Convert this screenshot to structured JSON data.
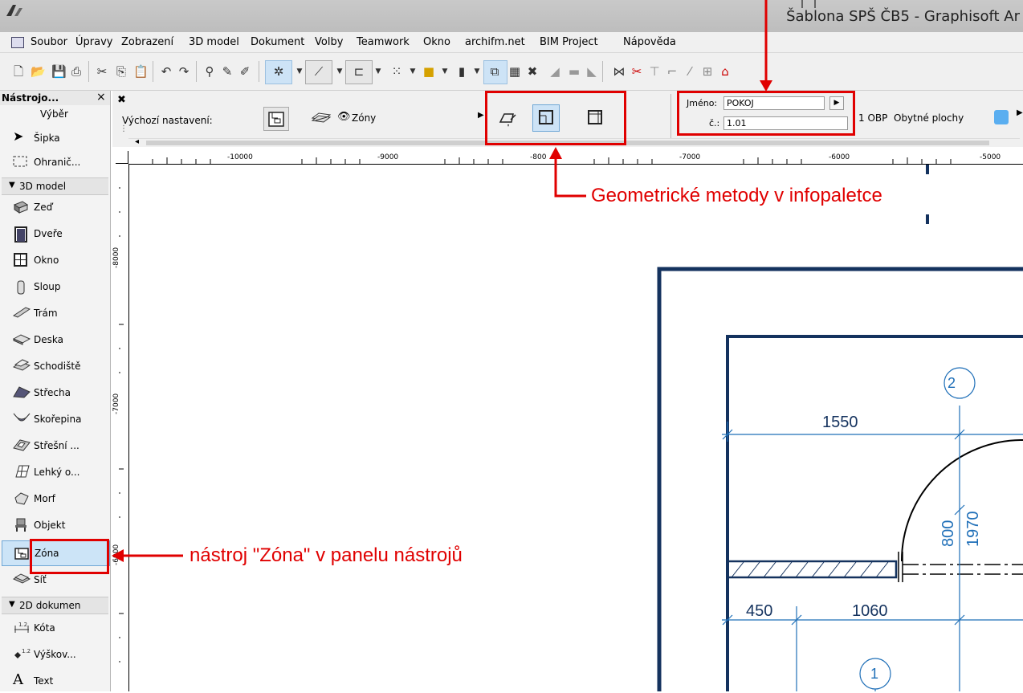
{
  "window": {
    "title": "Šablona SPŠ ČB5 - Graphisoft Ar"
  },
  "menu": [
    "Soubor",
    "Úpravy",
    "Zobrazení",
    "3D model",
    "Dokument",
    "Volby",
    "Teamwork",
    "Okno",
    "archifm.net",
    "BIM Project",
    "Nápověda"
  ],
  "toolbox": {
    "title": "Nástrojo...",
    "close": "×",
    "subtitle": "Výběr",
    "top_items": [
      {
        "label": "Šipka",
        "icon": "arrow-pointer-icon"
      },
      {
        "label": "Ohranič...",
        "icon": "marquee-icon"
      }
    ],
    "section_3d": "3D model",
    "items_3d": [
      {
        "label": "Zeď",
        "icon": "wall-icon"
      },
      {
        "label": "Dveře",
        "icon": "door-icon"
      },
      {
        "label": "Okno",
        "icon": "window-icon"
      },
      {
        "label": "Sloup",
        "icon": "column-icon"
      },
      {
        "label": "Trám",
        "icon": "beam-icon"
      },
      {
        "label": "Deska",
        "icon": "slab-icon"
      },
      {
        "label": "Schodiště",
        "icon": "stair-icon"
      },
      {
        "label": "Střecha",
        "icon": "roof-icon"
      },
      {
        "label": "Skořepina",
        "icon": "shell-icon"
      },
      {
        "label": "Střešní ...",
        "icon": "skylight-icon"
      },
      {
        "label": "Lehký o...",
        "icon": "curtain-wall-icon"
      },
      {
        "label": "Morf",
        "icon": "morph-icon"
      },
      {
        "label": "Objekt",
        "icon": "object-icon"
      },
      {
        "label": "Zóna",
        "icon": "zone-icon",
        "selected": true
      },
      {
        "label": "Síť",
        "icon": "mesh-icon"
      }
    ],
    "section_2d": "2D dokumen",
    "items_2d": [
      {
        "label": "Kóta",
        "icon": "dimension-icon"
      },
      {
        "label": "Výškov...",
        "icon": "level-dimension-icon"
      },
      {
        "label": "Text",
        "icon": "text-icon"
      }
    ]
  },
  "infopalette": {
    "default_settings": "Výchozí nastavení:",
    "layer": "Zóny",
    "name_label": "Jméno:",
    "name_value": "POKOJ",
    "number_label": "č.:",
    "number_value": "1.01",
    "category": "1 OBP  Obytné plochy",
    "category_color": "#5aaef0"
  },
  "ruler": {
    "h_labels": [
      "-10000",
      "-9000",
      "-800",
      "-7000",
      "-6000",
      "-5000"
    ],
    "v_labels": [
      "-8000",
      "-7000",
      "-6000"
    ]
  },
  "drawing": {
    "dims": [
      "1550",
      "1970",
      "800",
      "450",
      "1060"
    ],
    "grid_markers": [
      "2",
      "1"
    ]
  },
  "annotations": {
    "geometry_methods": "Geometrické metody v infopaletce",
    "zone_tool": "nástroj \"Zóna\" v panelu nástrojů"
  },
  "colors": {
    "accent_red": "#e00000",
    "dim_blue": "#1f6fb8",
    "wall_blue": "#14325e"
  }
}
